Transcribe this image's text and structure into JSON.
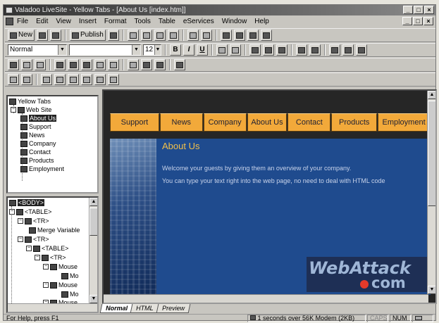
{
  "window": {
    "title": "Valadoo LiveSite - Yellow Tabs - [About Us [index.htm]]",
    "controls": [
      "_",
      "□",
      "×"
    ]
  },
  "menu": [
    "File",
    "Edit",
    "View",
    "Insert",
    "Format",
    "Tools",
    "Table",
    "eServices",
    "Window",
    "Help"
  ],
  "toolbar": {
    "new_label": "New",
    "publish_label": "Publish",
    "style_value": "Normal",
    "font_value": "",
    "size_value": "12",
    "bold": "B",
    "italic": "I",
    "underline": "U"
  },
  "site_tree": {
    "root": "Yellow Tabs",
    "web_site": "Web Site",
    "pages": [
      "About Us",
      "Support",
      "News",
      "Company",
      "Contact",
      "Products",
      "Employment"
    ],
    "selected": "About Us"
  },
  "dom_tree": {
    "nodes": [
      {
        "label": "<BODY>",
        "selected": true
      },
      {
        "label": "<TABLE>"
      },
      {
        "label": "<TR>"
      },
      {
        "label": "Merge Variable"
      },
      {
        "label": "<TR>"
      },
      {
        "label": "<TABLE>"
      },
      {
        "label": "<TR>"
      },
      {
        "label": "Mouse"
      },
      {
        "label": "Mo"
      },
      {
        "label": "Mouse"
      },
      {
        "label": "Mo"
      },
      {
        "label": "Mouse"
      }
    ]
  },
  "page": {
    "tabs": [
      "Support",
      "News",
      "Company",
      "About Us",
      "Contact",
      "Products",
      "Employment"
    ],
    "title": "About Us",
    "lines": [
      "Welcome your guests by giving them an overview of your company.",
      "You can type your text right into the web page, no need to deal with HTML code"
    ],
    "watermark_top": "WebAttack",
    "watermark_bottom": "com",
    "colors": {
      "tab": "#f2a93a",
      "content_bg": "#1f4b8e",
      "title": "#f2c04a"
    }
  },
  "view_tabs": [
    "Normal",
    "HTML",
    "Preview"
  ],
  "status": {
    "help": "For Help, press F1",
    "download": "1 seconds over 56K Modem (2KB)",
    "caps": "CAPS",
    "num": "NUM"
  }
}
